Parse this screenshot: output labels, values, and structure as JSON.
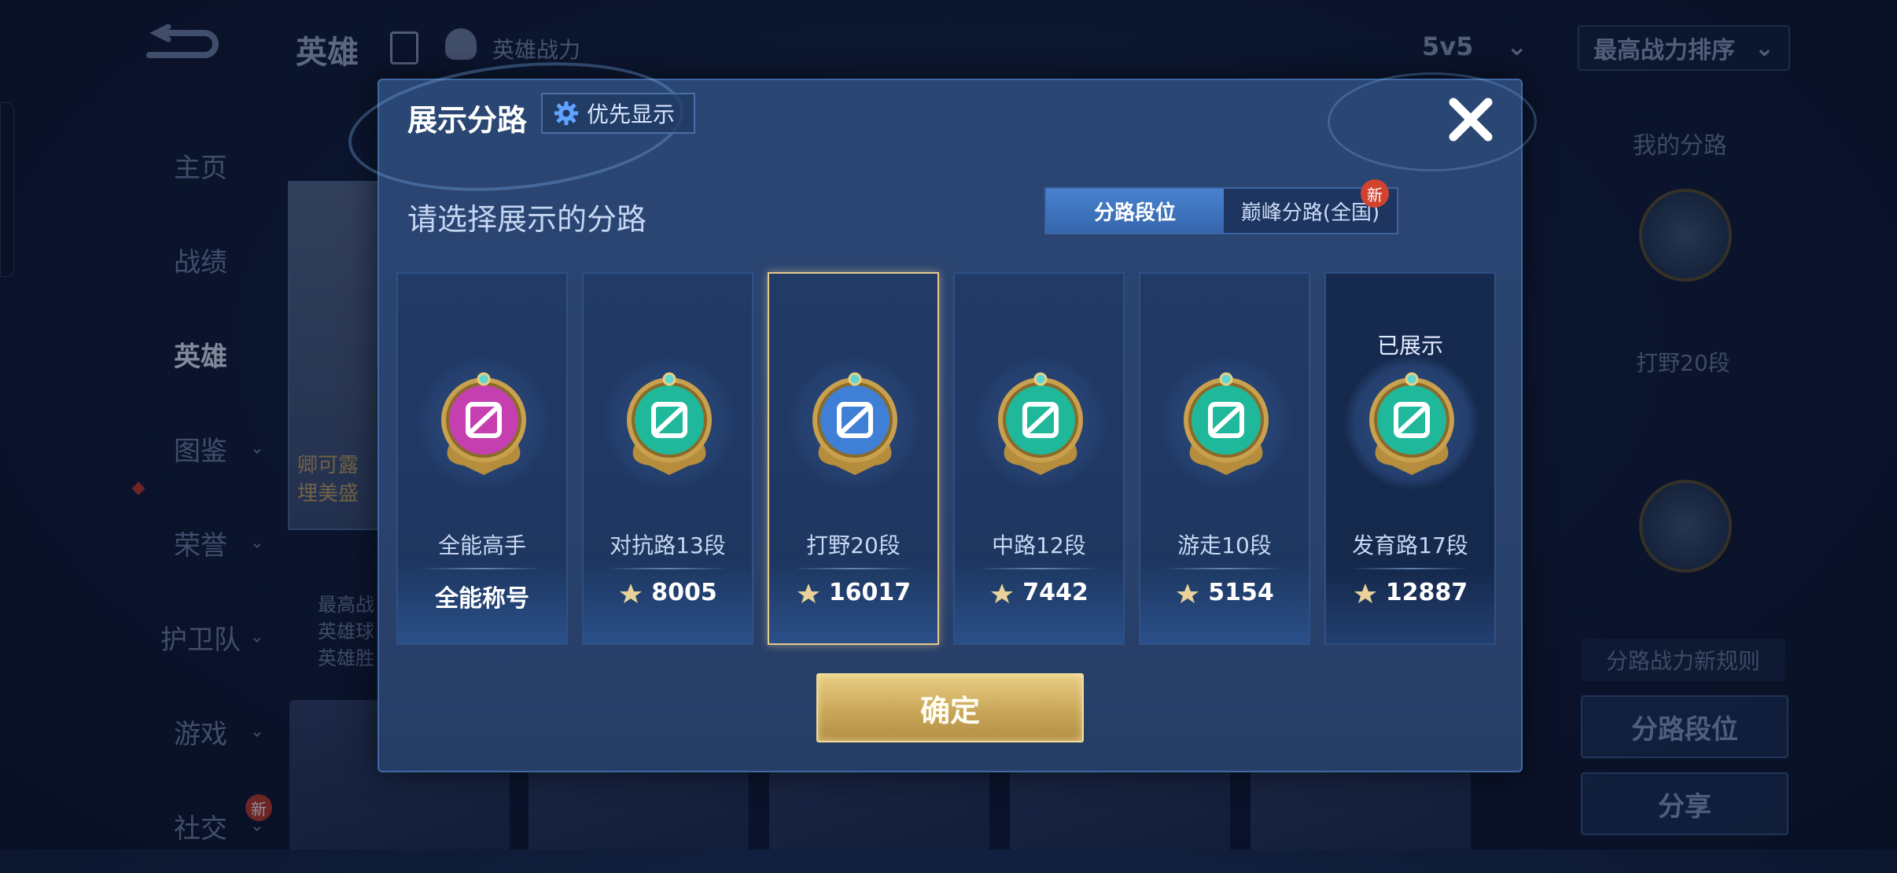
{
  "topbar": {
    "title": "英雄",
    "subtitle": "英雄战力",
    "mode": "5v5",
    "sort": "最高战力排序"
  },
  "sidenav": [
    {
      "label": "主页",
      "active": false,
      "chevron": false
    },
    {
      "label": "战绩",
      "active": false,
      "chevron": false
    },
    {
      "label": "英雄",
      "active": true,
      "chevron": false
    },
    {
      "label": "图鉴",
      "active": false,
      "chevron": true
    },
    {
      "label": "荣誉",
      "active": false,
      "chevron": true
    },
    {
      "label": "护卫队",
      "active": false,
      "chevron": true
    },
    {
      "label": "游戏",
      "active": false,
      "chevron": true
    },
    {
      "label": "社交",
      "active": false,
      "chevron": true,
      "badge": "新"
    }
  ],
  "background": {
    "hero_card_text": "卿可露\n埋美盛",
    "hero_info": [
      "最高战",
      "英雄球",
      "英雄胜"
    ]
  },
  "right_panel": {
    "title": "我的分路",
    "label": "打野20段",
    "rule": "分路战力新规则",
    "btn_lane_rank": "分路段位",
    "btn_share": "分享"
  },
  "modal": {
    "title": "展示分路",
    "priority_label": "优先显示",
    "prompt": "请选择展示的分路",
    "tabs": [
      {
        "label": "分路段位",
        "active": true
      },
      {
        "label": "巅峰分路(全国)",
        "active": false,
        "badge": "新"
      }
    ],
    "confirm": "确定",
    "cards": [
      {
        "name": "全能高手",
        "value": "全能称号",
        "emblem": "all-round-emblem-icon",
        "color": "#c63fb0",
        "selected": false,
        "displayed": false,
        "show_power_icon": false
      },
      {
        "name": "对抗路13段",
        "value": "8005",
        "emblem": "clash-lane-emblem-icon",
        "color": "#20b89a",
        "selected": false,
        "displayed": false,
        "show_power_icon": true
      },
      {
        "name": "打野20段",
        "value": "16017",
        "emblem": "jungle-emblem-icon",
        "color": "#3f7fd6",
        "selected": true,
        "displayed": false,
        "show_power_icon": true
      },
      {
        "name": "中路12段",
        "value": "7442",
        "emblem": "mid-lane-emblem-icon",
        "color": "#20b89a",
        "selected": false,
        "displayed": false,
        "show_power_icon": true
      },
      {
        "name": "游走10段",
        "value": "5154",
        "emblem": "roam-emblem-icon",
        "color": "#20b89a",
        "selected": false,
        "displayed": false,
        "show_power_icon": true
      },
      {
        "name": "发育路17段",
        "value": "12887",
        "emblem": "farm-lane-emblem-icon",
        "color": "#20b89a",
        "selected": false,
        "displayed": true,
        "show_power_icon": true
      }
    ],
    "displayed_label": "已展示"
  },
  "colors": {
    "gold": "#e6c98e",
    "accent_blue": "#3f7fd6",
    "teal": "#20b89a",
    "magenta": "#c63fb0"
  }
}
